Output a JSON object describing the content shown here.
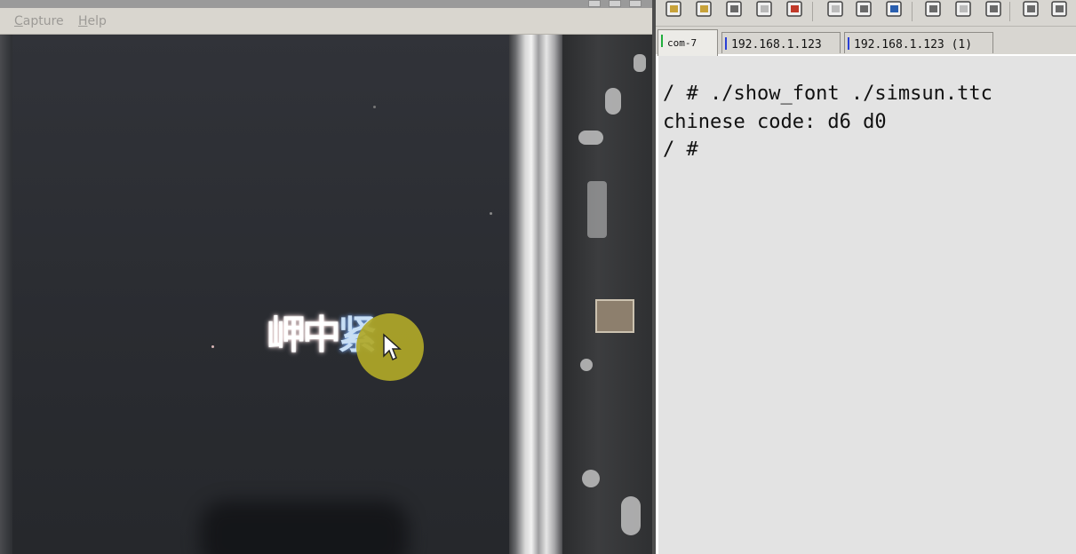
{
  "left_window": {
    "menu": [
      {
        "label": "Capture",
        "underline_index": 0
      },
      {
        "label": "Help",
        "underline_index": 0
      }
    ]
  },
  "lcd_display": {
    "char_1": "岬中",
    "char_2": "紧"
  },
  "right_window": {
    "toolbar_icons": [
      "new-session-icon",
      "reconnect-icon",
      "disconnect-icon",
      "properties-icon",
      "close-session-icon",
      "copy-icon",
      "paste-icon",
      "find-icon",
      "print-icon",
      "print-setup-icon",
      "printer-icon",
      "options-icon",
      "tools-icon"
    ],
    "tabs": [
      {
        "label": "com-7",
        "marker_color": "#1fae3c",
        "active": true
      },
      {
        "label": "192.168.1.123",
        "marker_color": "#2a3fd6",
        "active": false
      },
      {
        "label": "192.168.1.123 (1)",
        "marker_color": "#2a3fd6",
        "active": false
      }
    ],
    "terminal_lines": [
      "/ # ./show_font ./simsun.ttc",
      "chinese code: d6 d0",
      "/ #"
    ]
  },
  "colors": {
    "cursor_highlight": "#b0a828",
    "terminal_bg": "#e3e3e3",
    "menu_text": "#9c9a96"
  }
}
